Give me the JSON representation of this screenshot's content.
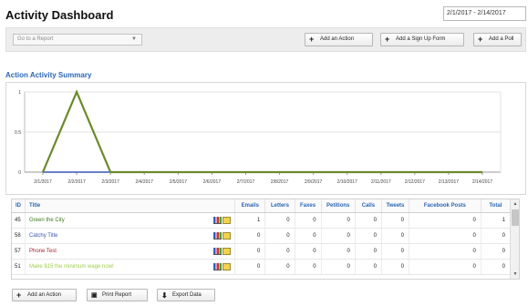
{
  "header": {
    "title": "Activity Dashboard",
    "date_range": "2/1/2017 - 2/14/2017"
  },
  "toolbar": {
    "report_select_placeholder": "Go to a Report",
    "add_action_label": "Add an Action",
    "add_signup_label": "Add a Sign Up Form",
    "add_poll_label": "Add a Poll"
  },
  "section": {
    "title": "Action Activity Summary"
  },
  "chart_data": {
    "type": "line",
    "categories": [
      "2/1/2017",
      "2/2/2017",
      "2/3/2017",
      "2/4/2017",
      "2/5/2017",
      "2/6/2017",
      "2/7/2017",
      "2/8/2017",
      "2/9/2017",
      "2/10/2017",
      "2/11/2017",
      "2/12/2017",
      "2/13/2017",
      "2/14/2017"
    ],
    "series": [
      {
        "values": [
          0,
          1,
          0,
          0,
          0,
          0,
          0,
          0,
          0,
          0,
          0,
          0,
          0,
          0
        ],
        "color": "#6b8a2c"
      },
      {
        "values": [
          0,
          0,
          0,
          0,
          0,
          0,
          0,
          0,
          0,
          0,
          0,
          0,
          0,
          0
        ],
        "color": "#3a57b5"
      }
    ],
    "yticks": [
      "0",
      "0.5",
      "1"
    ],
    "ylim": [
      0,
      1
    ],
    "grid": true
  },
  "table": {
    "columns": [
      "ID",
      "Title",
      "Emails",
      "Letters",
      "Faxes",
      "Petitions",
      "Calls",
      "Tweets",
      "Facebook Posts",
      "Total"
    ],
    "rows": [
      {
        "id": "45",
        "title": "Green the City",
        "title_color": "#3d7a1e",
        "values": [
          "1",
          "0",
          "0",
          "0",
          "0",
          "0",
          "0",
          "1"
        ]
      },
      {
        "id": "58",
        "title": "Catchy Title",
        "title_color": "#3b57b0",
        "values": [
          "0",
          "0",
          "0",
          "0",
          "0",
          "0",
          "0",
          "0"
        ]
      },
      {
        "id": "57",
        "title": "Phone Test",
        "title_color": "#a0282c",
        "values": [
          "0",
          "0",
          "0",
          "0",
          "0",
          "0",
          "0",
          "0"
        ]
      },
      {
        "id": "51",
        "title": "Make $15 the minimum wage now!",
        "title_color": "#9ed24a",
        "values": [
          "0",
          "0",
          "0",
          "0",
          "0",
          "0",
          "0",
          "0"
        ]
      }
    ]
  },
  "footer": {
    "add_action_label": "Add an Action",
    "print_report_label": "Print Report",
    "export_data_label": "Export Data"
  }
}
